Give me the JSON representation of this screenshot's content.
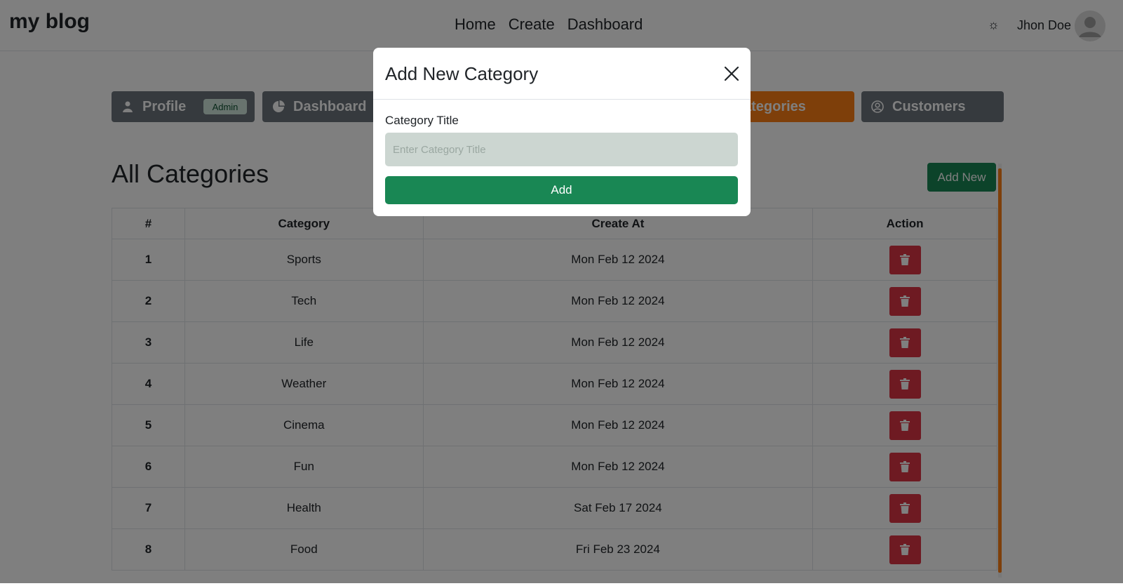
{
  "navbar": {
    "brand": "my blog",
    "links": [
      "Home",
      "Create",
      "Dashboard"
    ],
    "theme_icon": "sun-icon",
    "user_name": "Jhon Doe",
    "avatar_icon": "user-avatar-icon"
  },
  "tabs": {
    "profile": "Profile",
    "admin_badge": "Admin",
    "dashboard": "Dashboard",
    "categories": "ategories",
    "customers": "Customers"
  },
  "main": {
    "title": "All Categories",
    "add_new_label": "Add New"
  },
  "table": {
    "headers": [
      "#",
      "Category",
      "Create At",
      "Action"
    ],
    "rows": [
      {
        "num": "1",
        "category": "Sports",
        "date": "Mon Feb 12 2024"
      },
      {
        "num": "2",
        "category": "Tech",
        "date": "Mon Feb 12 2024"
      },
      {
        "num": "3",
        "category": "Life",
        "date": "Mon Feb 12 2024"
      },
      {
        "num": "4",
        "category": "Weather",
        "date": "Mon Feb 12 2024"
      },
      {
        "num": "5",
        "category": "Cinema",
        "date": "Mon Feb 12 2024"
      },
      {
        "num": "6",
        "category": "Fun",
        "date": "Mon Feb 12 2024"
      },
      {
        "num": "7",
        "category": "Health",
        "date": "Sat Feb 17 2024"
      },
      {
        "num": "8",
        "category": "Food",
        "date": "Fri Feb 23 2024"
      }
    ]
  },
  "modal": {
    "title": "Add New Category",
    "field_label": "Category Title",
    "placeholder": "Enter Category Title",
    "add_label": "Add"
  },
  "colors": {
    "primary_green": "#198754",
    "danger_red": "#dc3545",
    "tab_gray": "#6c757d",
    "active_orange": "#fd7e14"
  }
}
